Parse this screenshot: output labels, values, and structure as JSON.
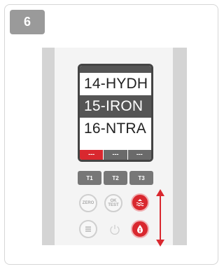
{
  "step": {
    "number": "6"
  },
  "screen": {
    "menu": [
      "14-HYDH",
      "15-IRON",
      "16-NTRA"
    ],
    "selected_index": 1,
    "tabs": [
      "---",
      "---",
      "---"
    ],
    "active_tab_index": 0
  },
  "keypad": {
    "function_keys": [
      "T1",
      "T2",
      "T3"
    ],
    "zero_label": "ZERO",
    "ok_label": "OK",
    "test_label": "TEST",
    "menu_icon": "menu-lines-icon",
    "power_icon": "power-icon",
    "scroll_up_icon": "water-level-up-icon",
    "scroll_down_icon": "info-drop-icon"
  },
  "annotations": {
    "arrow_color": "#d9282f",
    "arrow_icons": [
      "arrow-up-icon",
      "arrow-down-icon"
    ]
  },
  "colors": {
    "accent_red": "#d9282f",
    "badge_gray": "#9a9a9a",
    "panel_gray": "#d4d4d4"
  }
}
